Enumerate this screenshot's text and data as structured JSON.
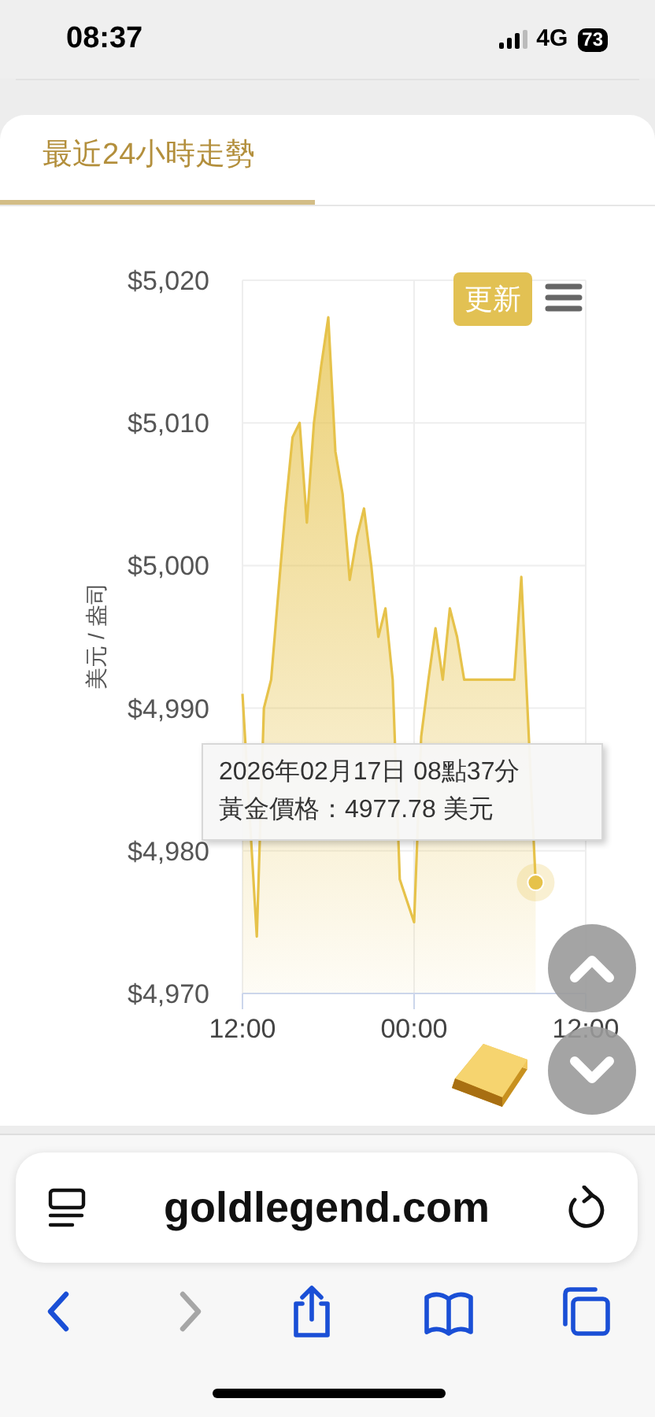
{
  "status_bar": {
    "time": "08:37",
    "network": "4G",
    "battery": "73"
  },
  "tabs": [
    {
      "label": "最近24小時走勢",
      "selected": true
    }
  ],
  "chart": {
    "refresh_button": "更新",
    "tooltip": {
      "date": "2026年02月17日 08點37分",
      "price": "黃金價格：4977.78 美元"
    },
    "chart_data": {
      "type": "area",
      "ylabel": "美元 / 盎司",
      "categories": [
        "12:00",
        null,
        null,
        null,
        null,
        null,
        null,
        null,
        null,
        null,
        null,
        null,
        null,
        null,
        null,
        null,
        null,
        null,
        null,
        null,
        null,
        null,
        null,
        null,
        "00:00",
        null,
        null,
        null,
        null,
        null,
        null,
        null,
        null,
        null,
        null,
        null,
        null,
        null,
        null,
        null,
        null,
        null,
        null,
        null,
        null,
        null,
        null,
        null,
        "12:00"
      ],
      "series": [
        {
          "color": "#e6c24a",
          "values": [
            4991,
            null,
            4974,
            4990,
            4992,
            4998,
            5004,
            5009,
            5010,
            5003,
            5010,
            5014,
            5017.4,
            5008,
            5005,
            4999,
            5002,
            5004,
            5000,
            4995,
            4997,
            4992,
            4978,
            null,
            4975,
            4988,
            4992,
            4995.6,
            4992,
            4997,
            4995,
            4992,
            4992,
            4992,
            4992,
            4992,
            4992,
            4992,
            4992,
            4999.2,
            null,
            4977.78,
            null,
            null,
            null,
            null,
            null,
            null,
            null
          ]
        }
      ],
      "ylim": [
        4970,
        5020
      ],
      "grid": true,
      "yticks": [
        {
          "value": 4970,
          "label": "$4,970"
        },
        {
          "value": 4980,
          "label": "$4,980"
        },
        {
          "value": 4990,
          "label": "$4,990"
        },
        {
          "value": 5000,
          "label": "$5,000"
        },
        {
          "value": 5010,
          "label": "$5,010"
        },
        {
          "value": 5020,
          "label": "$5,020"
        }
      ]
    }
  },
  "browser": {
    "url": "goldlegend.com",
    "toolbar": [
      {
        "kind": "back",
        "disabled": false
      },
      {
        "kind": "forward",
        "disabled": true
      },
      {
        "kind": "share",
        "disabled": false
      },
      {
        "kind": "bookmarks",
        "disabled": false
      },
      {
        "kind": "tabs",
        "disabled": false
      }
    ]
  }
}
